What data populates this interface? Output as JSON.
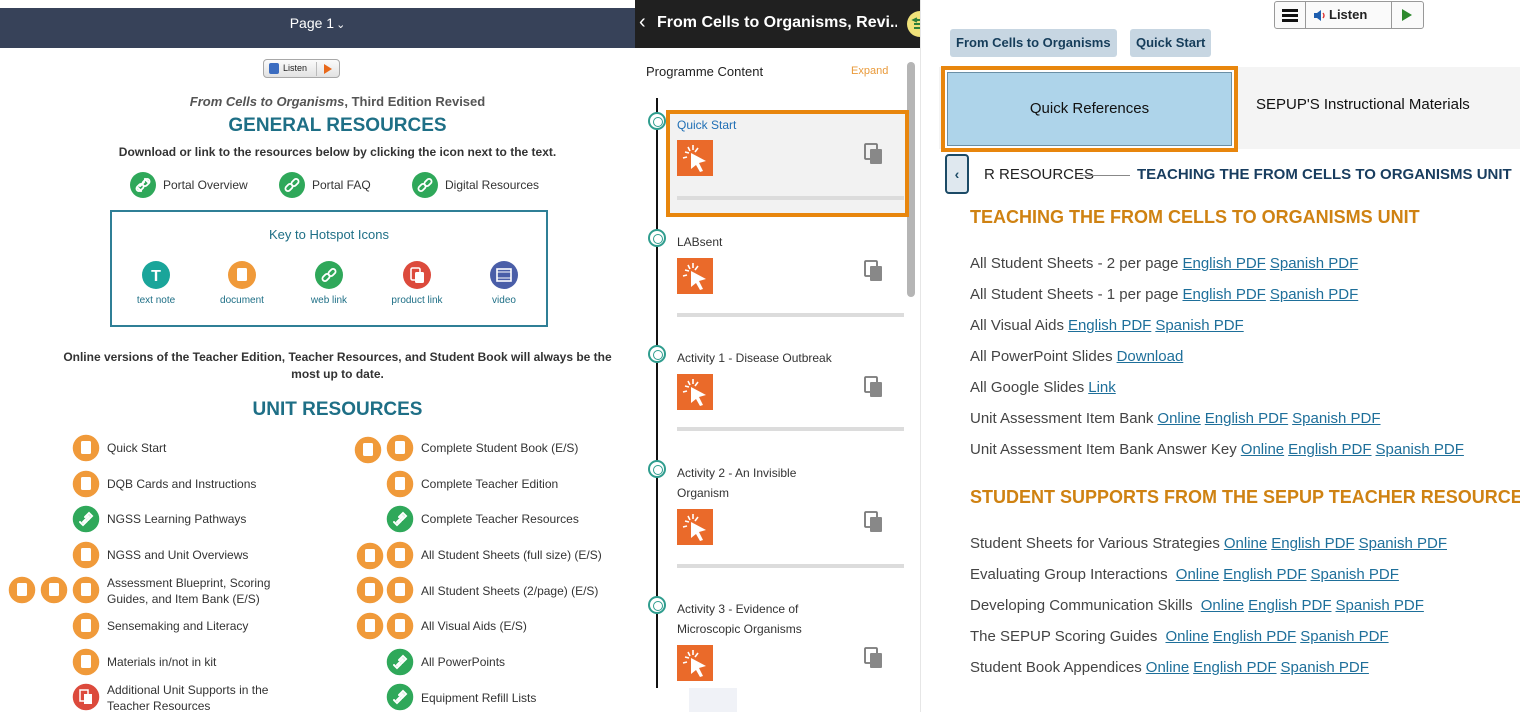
{
  "left_doc": {
    "page_label": "Page 1",
    "listen_label": "Listen",
    "subtitle_italic": "From Cells to Organisms",
    "subtitle_rest": ", Third Edition Revised",
    "general_title": "GENERAL RESOURCES",
    "general_note": "Download or link to the resources below by clicking the icon next to the text.",
    "general_links": [
      "Portal Overview",
      "Portal FAQ",
      "Digital Resources"
    ],
    "key_title": "Key to Hotspot Icons",
    "key_items": [
      "text note",
      "document",
      "web link",
      "product link",
      "video"
    ],
    "online_note_line1": "Online versions of the Teacher Edition, Teacher Resources, and Student Book will always be the",
    "online_note_line2": "most up to date.",
    "unit_title": "UNIT RESOURCES",
    "unit_left": [
      "Quick Start",
      "DQB Cards and Instructions",
      "NGSS Learning Pathways",
      "NGSS and Unit Overviews",
      "Assessment Blueprint, Scoring",
      "Guides, and Item Bank (E/S)",
      "Sensemaking and Literacy",
      "Materials in/not in kit",
      "Additional Unit Supports in the",
      "Teacher Resources"
    ],
    "unit_right": [
      "Complete Student Book (E/S)",
      "Complete Teacher Edition",
      "Complete Teacher Resources",
      "All Student Sheets (full size) (E/S)",
      "All Student Sheets (2/page) (E/S)",
      "All Visual Aids (E/S)",
      "All PowerPoints",
      "Equipment Refill Lists"
    ]
  },
  "mid_panel": {
    "title": "From Cells to Organisms, Revi...",
    "section_label": "Programme Content",
    "expand_label": "Expand",
    "lessons": [
      "Quick Start",
      "LABsent",
      "Activity 1 - Disease Outbreak",
      "Activity 2 - An Invisible",
      "Organism",
      "Activity 3 - Evidence of",
      "Microscopic Organisms"
    ]
  },
  "right_panel": {
    "listen_label": "Listen",
    "crumbs": [
      "From Cells to Organisms",
      "Quick Start"
    ],
    "tab_active": "Quick References",
    "tab_other": "SEPUP'S Instructional Materials",
    "prev_section_partial": "R RESOURCES",
    "current_section": "TEACHING THE FROM CELLS TO ORGANISMS UNIT",
    "heading1": "TEACHING THE FROM CELLS TO ORGANISMS UNIT",
    "rows1": [
      {
        "label": "All Student Sheets - 2 per page",
        "links": [
          "English PDF",
          "Spanish PDF"
        ]
      },
      {
        "label": "All Student Sheets - 1 per page",
        "links": [
          "English PDF",
          "Spanish PDF"
        ]
      },
      {
        "label": "All Visual Aids",
        "links": [
          "English PDF",
          "Spanish PDF"
        ]
      },
      {
        "label": "All PowerPoint Slides",
        "links": [
          "Download"
        ]
      },
      {
        "label": "All Google Slides",
        "links": [
          "Link"
        ]
      },
      {
        "label": "Unit Assessment Item Bank",
        "links": [
          "Online",
          "English PDF",
          "Spanish PDF"
        ]
      },
      {
        "label": "Unit Assessment Item Bank Answer Key",
        "links": [
          "Online",
          "English PDF",
          "Spanish PDF"
        ]
      }
    ],
    "heading2": "STUDENT SUPPORTS FROM THE SEPUP TEACHER RESOURCES",
    "rows2": [
      {
        "label": "Student Sheets for Various Strategies",
        "links": [
          "Online",
          "English PDF",
          "Spanish PDF"
        ]
      },
      {
        "label": "Evaluating Group Interactions ",
        "links": [
          "Online",
          "English PDF",
          "Spanish PDF"
        ]
      },
      {
        "label": "Developing Communication Skills ",
        "links": [
          "Online",
          "English PDF",
          "Spanish PDF"
        ]
      },
      {
        "label": "The SEPUP Scoring Guides ",
        "links": [
          "Online",
          "English PDF",
          "Spanish PDF"
        ]
      },
      {
        "label": "Student Book Appendices",
        "links": [
          "Online",
          "English PDF",
          "Spanish PDF"
        ]
      }
    ]
  },
  "colors": {
    "orange_accent": "#e8860d",
    "teal_title": "#1e6f86",
    "header_dark": "#374259",
    "heading_gold": "#cf8212",
    "link_blue": "#1e6f9a"
  }
}
